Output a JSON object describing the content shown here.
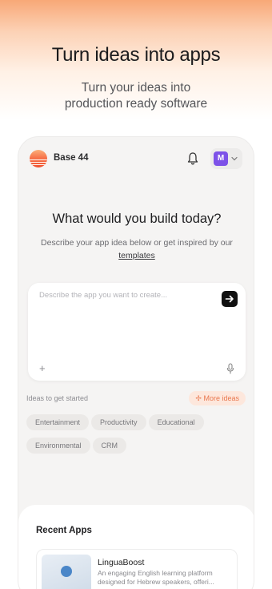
{
  "hero": {
    "title": "Turn ideas into apps",
    "subtitle_line1": "Turn your ideas into",
    "subtitle_line2": "production ready software"
  },
  "topbar": {
    "brand": "Base 44",
    "avatar_initial": "M",
    "icons": [
      "logo-icon",
      "bell-icon",
      "chevron-down-icon"
    ]
  },
  "main": {
    "headline": "What would you build today?",
    "description": "Describe your app idea below or get inspired by our",
    "description_link": "templates",
    "prompt_placeholder": "Describe the app you want to create...",
    "plus_label": "+",
    "ideas_label": "Ideas to get started",
    "more_ideas_label": "More ideas",
    "chips": [
      "Entertainment",
      "Productivity",
      "Educational",
      "Environmental",
      "CRM"
    ]
  },
  "recent": {
    "title": "Recent Apps",
    "apps": [
      {
        "name": "LinguaBoost",
        "description": "An engaging English learning platform designed for Hebrew speakers, offeri..."
      }
    ]
  },
  "colors": {
    "accent": "#f0502e",
    "avatar": "#7d52e8",
    "more_ideas_bg": "#fde7dc",
    "more_ideas_text": "#e9784f"
  }
}
